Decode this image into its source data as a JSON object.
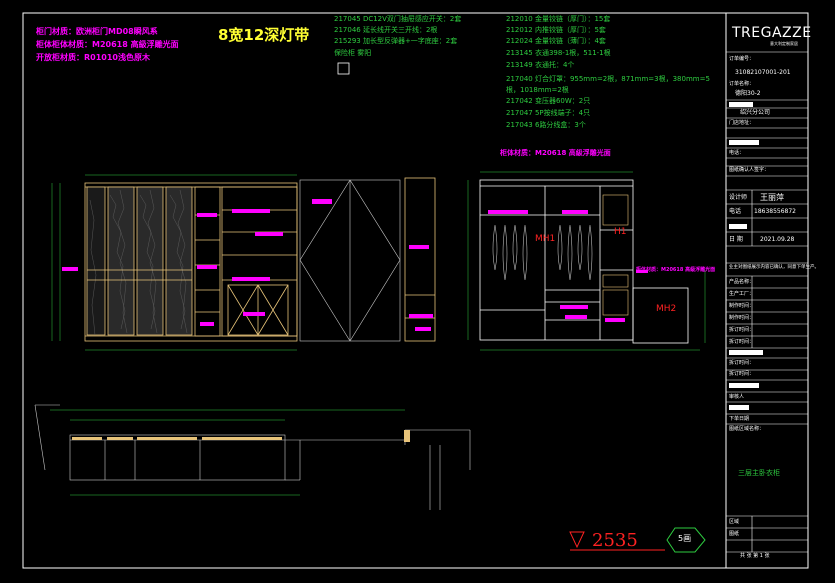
{
  "notes_left": [
    "柜门材质：欧洲柜门MD08瞬风系",
    "柜体柜体材质：M20618 高級浮雕光面",
    "开放柜材质：R01010浅色原木"
  ],
  "title_note": "8宽12深灯带",
  "parts_col1": [
    "217045 DC12V双门抽屉感应开关：2套",
    "217046 延长线开关三开线：2根",
    "215293 加长型反弹器+一字底座：2套",
    "保险柜 雾阳"
  ],
  "parts_col2": [
    "212010 金量铰链（厚门）：15套",
    "212012 内推铰链（厚门）：5套",
    "212024 金量铰链（薄门）：4套",
    "213145 衣通398-1根，511-1根",
    "213149 衣通托：4个",
    "217040 灯合灯罩：955mm=2根，871mm=3根，380mm=5根，1018mm=2根",
    "217042 变压器60W：2只",
    "217047 5P按线端子：4只",
    "217043 6路分线盒：3个"
  ],
  "sec_note_top": "柜体材质：M20618 高級浮雕光面",
  "sec_note_mid": "柜体材质：M20618 高級浮雕光面",
  "labels": {
    "mh1": "MH1",
    "h1": "H1",
    "mh2": "MH2"
  },
  "level_mark": "2535",
  "section_mark": "5画",
  "title_block": {
    "logo": "TREGAZZE",
    "logo_sub": "意大利定制家居",
    "order_no_label": "订单编号：",
    "order_no": "31082107001-201",
    "order_name_label": "订单名称：",
    "order_name": "德阳30-2",
    "rows_a": [
      "",
      "绍兴分公司",
      "门店地址：",
      "",
      "电话：",
      "图纸确认人签字："
    ],
    "designer_label": "设计师",
    "designer": "王丽萍",
    "phone_label": "电话",
    "phone": "18638556872",
    "date_label": "日  期",
    "date": "2021.09.28",
    "confirm_text": "业主对图纸展示内容已确认，同意下单生产。",
    "rows_b": [
      "产品名称：",
      "生产工厂：",
      "制作时间：",
      "制作时间：",
      "拆订时间：",
      "拆订时间：",
      "",
      "拆订时间：",
      "拆订时间：",
      "审核人",
      "",
      "下单日期"
    ],
    "drawing_name_label": "图纸区域名称：",
    "drawing_name": "三层主卧衣柜",
    "bottom": [
      "区域",
      "图纸",
      "共   张   第   1   张"
    ]
  }
}
